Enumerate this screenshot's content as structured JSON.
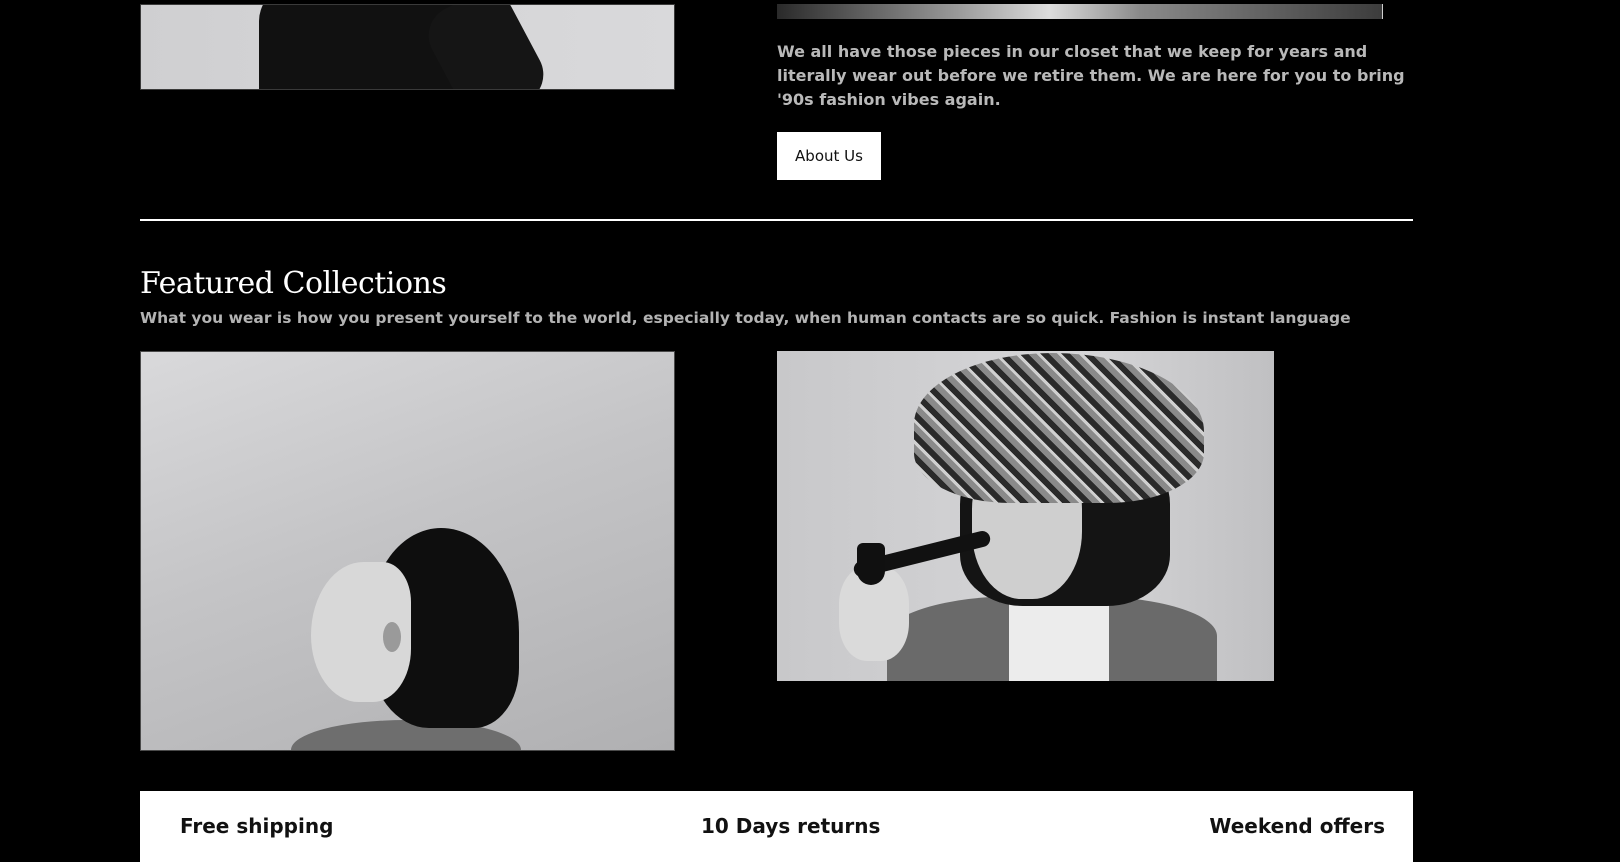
{
  "about": {
    "text": "We all have those pieces in our closet that we keep for years and literally wear out before we retire them. We are here for you to bring '90s fashion vibes again.",
    "button_label": "About Us"
  },
  "featured": {
    "title": "Featured Collections",
    "subtitle": "What you wear is how you present yourself to the world, especially today, when human contacts are so quick. Fashion is instant language"
  },
  "benefits": [
    {
      "label": "Free shipping"
    },
    {
      "label": "10 Days returns"
    },
    {
      "label": "Weekend offers"
    }
  ],
  "colors": {
    "background": "#000000",
    "text": "#ffffff",
    "muted_text": "#b9b9b9",
    "button_bg": "#ffffff",
    "button_text": "#111111"
  }
}
